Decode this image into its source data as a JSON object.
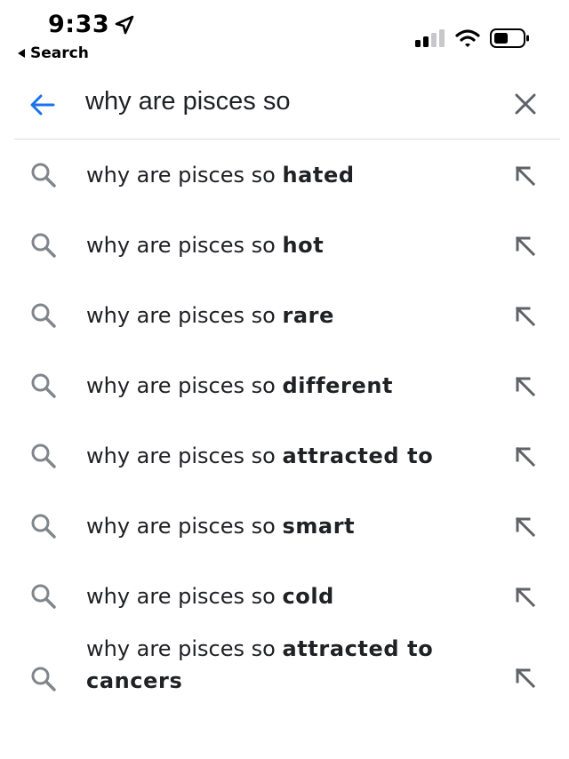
{
  "status_bar": {
    "time": "9:33",
    "back_app": "Search",
    "location_icon": "location-arrow-icon",
    "signal_icon": "cellular-signal-icon",
    "wifi_icon": "wifi-icon",
    "battery_icon": "battery-icon"
  },
  "search": {
    "query": "why are pisces so",
    "back_icon": "back-arrow-icon",
    "clear_icon": "close-icon",
    "accent_color": "#1a73e8"
  },
  "suggestions": [
    {
      "prefix": "why are pisces so ",
      "completion": "hated"
    },
    {
      "prefix": "why are pisces so ",
      "completion": "hot"
    },
    {
      "prefix": "why are pisces so ",
      "completion": "rare"
    },
    {
      "prefix": "why are pisces so ",
      "completion": "different"
    },
    {
      "prefix": "why are pisces so ",
      "completion": "attracted to"
    },
    {
      "prefix": "why are pisces so ",
      "completion": "smart"
    },
    {
      "prefix": "why are pisces so ",
      "completion": "cold"
    },
    {
      "prefix": "why are pisces so ",
      "completion": "attracted to cancers"
    }
  ],
  "icons": {
    "suggestion_icon": "search-icon",
    "fill_icon": "arrow-up-left-icon"
  }
}
